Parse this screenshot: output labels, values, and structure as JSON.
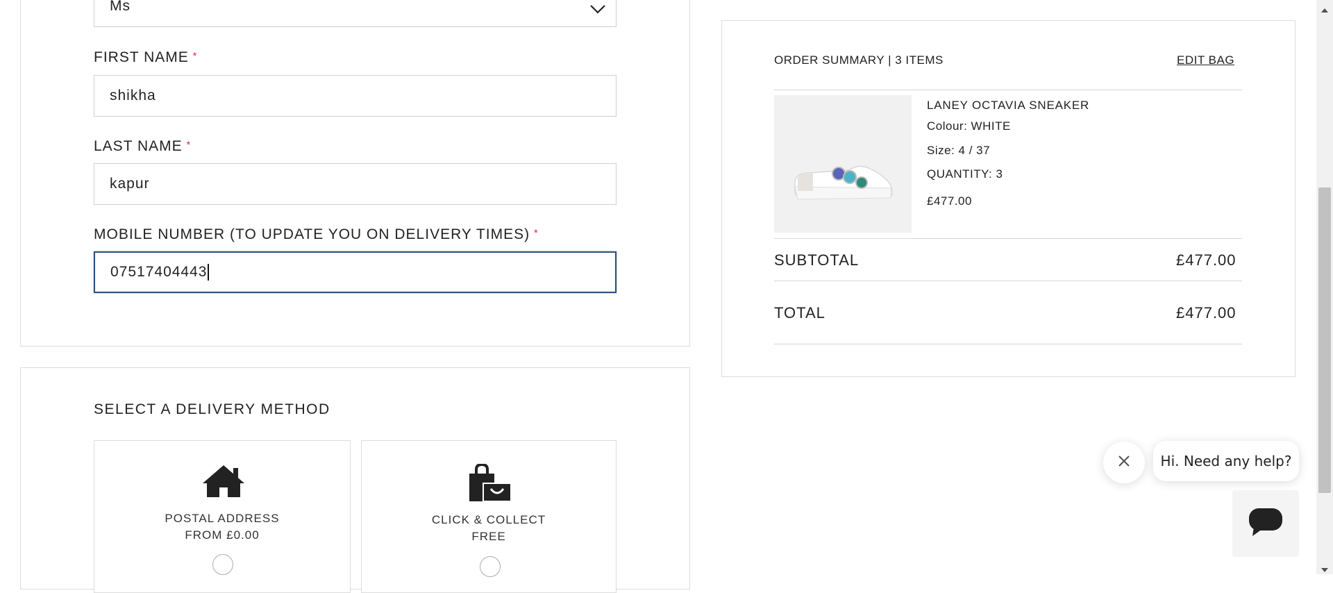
{
  "form": {
    "title_value": "Ms",
    "first_name": {
      "label": "FIRST NAME",
      "required_mark": "*",
      "value": "shikha"
    },
    "last_name": {
      "label": "LAST NAME",
      "required_mark": "*",
      "value": "kapur"
    },
    "mobile": {
      "label": "MOBILE NUMBER (TO UPDATE YOU ON DELIVERY TIMES)",
      "required_mark": "*",
      "value": "07517404443"
    }
  },
  "delivery": {
    "title": "SELECT A DELIVERY METHOD",
    "options": [
      {
        "line1": "POSTAL ADDRESS",
        "line2": "FROM £0.00",
        "icon": "house-icon"
      },
      {
        "line1": "CLICK & COLLECT",
        "line2": "FREE",
        "icon": "shopping-bag-icon"
      }
    ]
  },
  "summary": {
    "heading": "ORDER SUMMARY | 3 ITEMS",
    "edit_bag": "EDIT BAG",
    "item": {
      "name": "LANEY OCTAVIA SNEAKER",
      "colour": "Colour: WHITE",
      "size": "Size: 4 / 37",
      "quantity": "QUANTITY: 3",
      "price": "£477.00"
    },
    "subtotal_label": "SUBTOTAL",
    "subtotal_value": "£477.00",
    "total_label": "TOTAL",
    "total_value": "£477.00"
  },
  "chat": {
    "greeting": "Hi. Need any help?"
  }
}
